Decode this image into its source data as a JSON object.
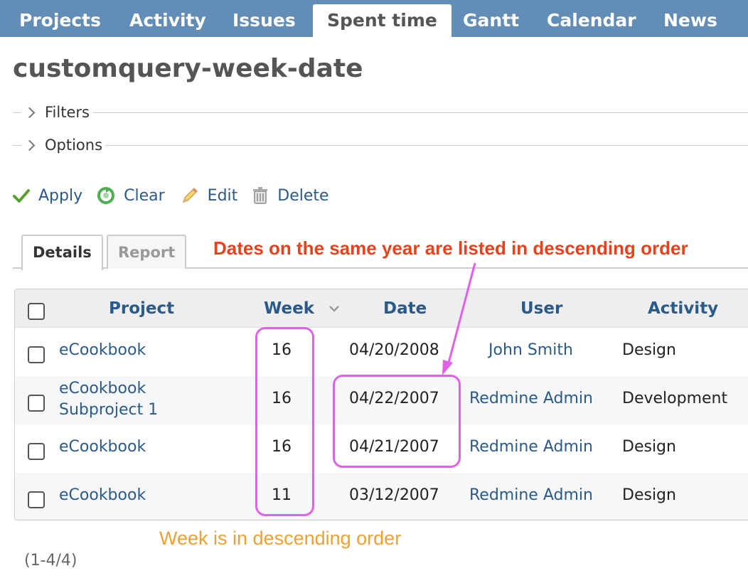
{
  "nav": {
    "tabs": [
      {
        "label": "Projects"
      },
      {
        "label": "Activity"
      },
      {
        "label": "Issues"
      },
      {
        "label": "Spent time",
        "active": true
      },
      {
        "label": "Gantt"
      },
      {
        "label": "Calendar"
      },
      {
        "label": "News"
      }
    ]
  },
  "page": {
    "title": "customquery-week-date"
  },
  "sections": {
    "filters": "Filters",
    "options": "Options"
  },
  "actions": {
    "apply": "Apply",
    "clear": "Clear",
    "edit": "Edit",
    "delete": "Delete"
  },
  "subtabs": {
    "details": "Details",
    "report": "Report"
  },
  "annotations": {
    "dates": "Dates on the same year are listed in descending order",
    "week": "Week is in descending order"
  },
  "table": {
    "columns": {
      "project": "Project",
      "week": "Week",
      "date": "Date",
      "user": "User",
      "activity": "Activity"
    },
    "rows": [
      {
        "project": "eCookbook",
        "week": "16",
        "date": "04/20/2008",
        "user": "John Smith",
        "activity": "Design"
      },
      {
        "project_line1": "eCookbook",
        "project_line2": "Subproject 1",
        "week": "16",
        "date": "04/22/2007",
        "user": "Redmine Admin",
        "activity": "Development"
      },
      {
        "project": "eCookbook",
        "week": "16",
        "date": "04/21/2007",
        "user": "Redmine Admin",
        "activity": "Design"
      },
      {
        "project": "eCookbook",
        "week": "11",
        "date": "03/12/2007",
        "user": "Redmine Admin",
        "activity": "Design"
      }
    ]
  },
  "pagination": {
    "count": "(1-4/4)"
  },
  "colors": {
    "nav": "#628db6",
    "link": "#2a5a8a",
    "highlight": "#e060e8",
    "annotation_red": "#e8411c",
    "annotation_orange": "#f0a030"
  }
}
